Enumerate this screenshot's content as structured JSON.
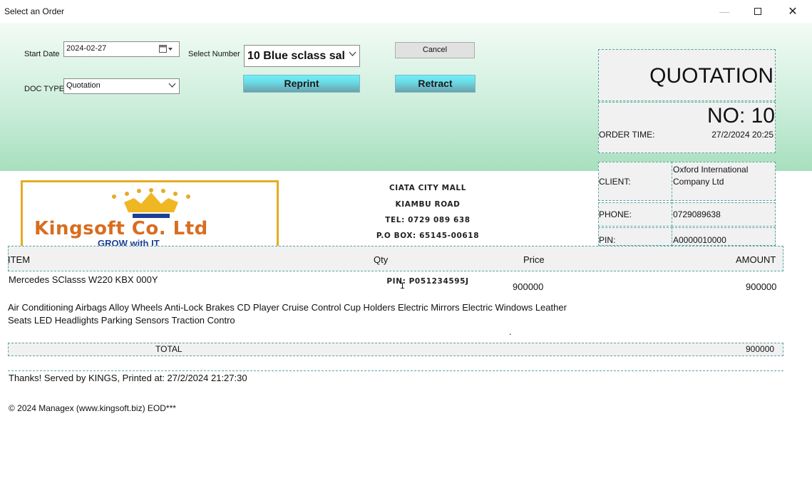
{
  "window": {
    "title": "Select an Order"
  },
  "controls": {
    "start_date_label": "Start Date",
    "start_date_value": "2024-02-27",
    "select_number_label": "Select Number",
    "select_number_value": "10 Blue sclass sal",
    "doc_type_label": "DOC TYPE",
    "doc_type_value": "Quotation",
    "cancel_label": "Cancel",
    "reprint_label": "Reprint",
    "retract_label": "Retract"
  },
  "doc_header": {
    "type": "QUOTATION",
    "number": "NO: 10",
    "order_time_label": "ORDER TIME:",
    "order_time_value": "27/2/2024 20:25",
    "client_label": "CLIENT:",
    "client_value": "Oxford International Company Ltd",
    "phone_label": "PHONE:",
    "phone_value": "0729089638",
    "pin_label": "PIN:",
    "pin_value": "A0000010000"
  },
  "company": {
    "name": "Kingsoft Co. Ltd",
    "slogan": "GROW with IT",
    "address_lines": [
      "CIATA CITY MALL",
      "KIAMBU ROAD",
      "TEL: 0729 089 638",
      "P.O BOX: 65145-00618"
    ],
    "pin": "PIN: P051234595J"
  },
  "table": {
    "headers": {
      "item": "ITEM",
      "qty": "Qty",
      "price": "Price",
      "amount": "AMOUNT"
    },
    "rows": [
      {
        "item": "Mercedes SClasss W220 KBX 000Y",
        "qty": "1",
        "price": "900000",
        "amount": "900000"
      }
    ],
    "features": "Air Conditioning  Airbags  Alloy Wheels  Anti-Lock Brakes  CD Player  Cruise Control  Cup Holders  Electric Mirrors  Electric Windows  Leather Seats  LED Headlights  Parking Sensors  Traction Contro",
    "dot": ".",
    "total_label": "TOTAL",
    "total_value": "900000"
  },
  "footer": {
    "served_line": "Thanks! Served by KINGS, Printed at: 27/2/2024 21:27:30",
    "copyright": "© 2024 Managex (www.kingsoft.biz) EOD***"
  },
  "icons": {
    "calendar": "calendar-icon",
    "dropdown": "chevron-down-icon"
  },
  "colors": {
    "accent_cyan": "#6bdbe6",
    "header_green": "#a7dfbe",
    "logo_gold": "#e4ac25",
    "logo_orange": "#d96d1f",
    "logo_blue": "#1b3f95",
    "dashed_border": "#5aa3a3"
  }
}
